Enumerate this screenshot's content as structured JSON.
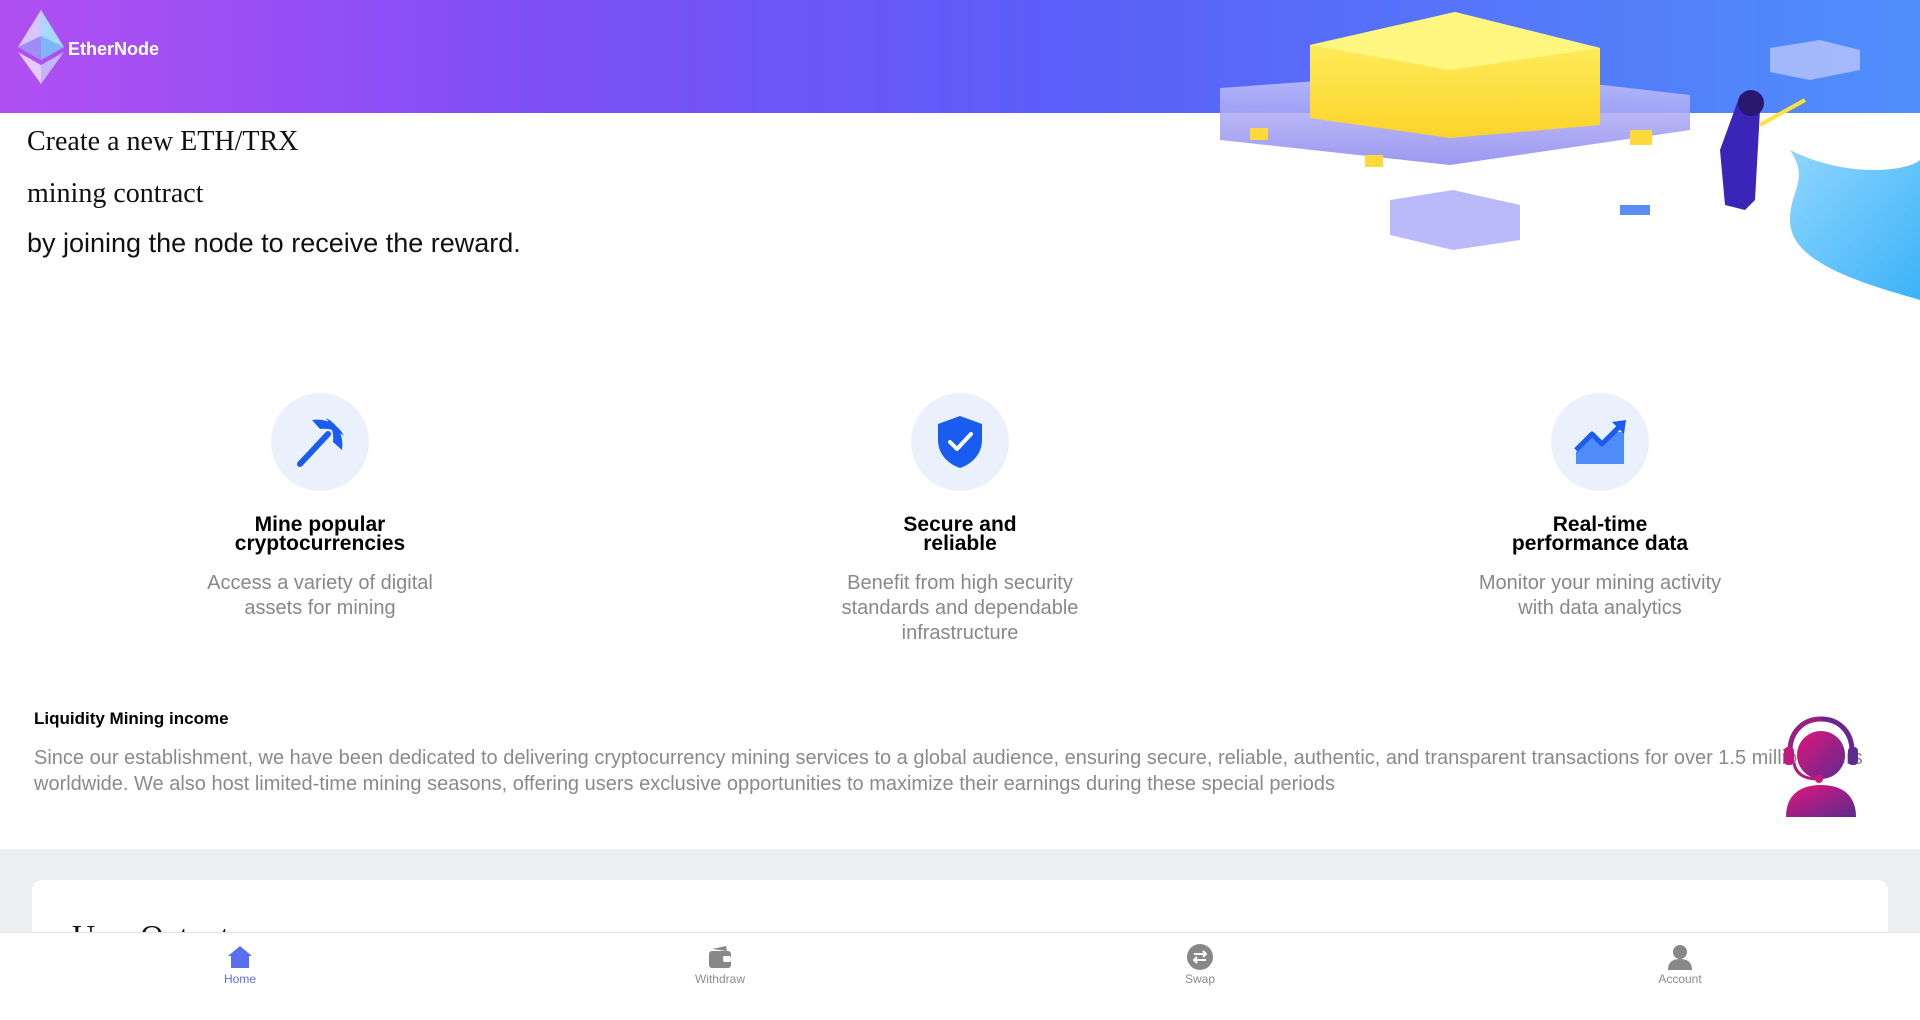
{
  "header": {
    "brand": "EtherNode"
  },
  "hero": {
    "line1": "Create a new ETH/TRX",
    "line2": "mining contract",
    "line3": "by joining the node to receive the reward."
  },
  "features": [
    {
      "title_line1": "Mine popular",
      "title_line2": "cryptocurrencies",
      "description": "Access a variety of digital assets for mining",
      "icon": "pickaxe-icon"
    },
    {
      "title_line1": "Secure and",
      "title_line2": "reliable",
      "description": "Benefit from high security standards and dependable infrastructure",
      "icon": "shield-check-icon"
    },
    {
      "title_line1": "Real-time",
      "title_line2": "performance data",
      "description": "Monitor your mining activity with data analytics",
      "icon": "trending-up-icon"
    }
  ],
  "liquidity": {
    "title": "Liquidity Mining income",
    "text": "Since our establishment, we have been dedicated to delivering cryptocurrency mining services to a global audience, ensuring secure, reliable, authentic, and transparent transactions for over 1.5 million users worldwide. We also host limited-time mining seasons, offering users exclusive opportunities to maximize their earnings during these special periods"
  },
  "card": {
    "title": "User Output"
  },
  "nav": {
    "items": [
      {
        "label": "Home",
        "icon": "home-icon",
        "active": true
      },
      {
        "label": "Withdraw",
        "icon": "wallet-icon",
        "active": false
      },
      {
        "label": "Swap",
        "icon": "swap-icon",
        "active": false
      },
      {
        "label": "Account",
        "icon": "user-icon",
        "active": false
      }
    ]
  },
  "colors": {
    "accent": "#5a6ff0",
    "feature_icon": "#1a5cf0",
    "icon_bg": "#eaf1fd"
  }
}
